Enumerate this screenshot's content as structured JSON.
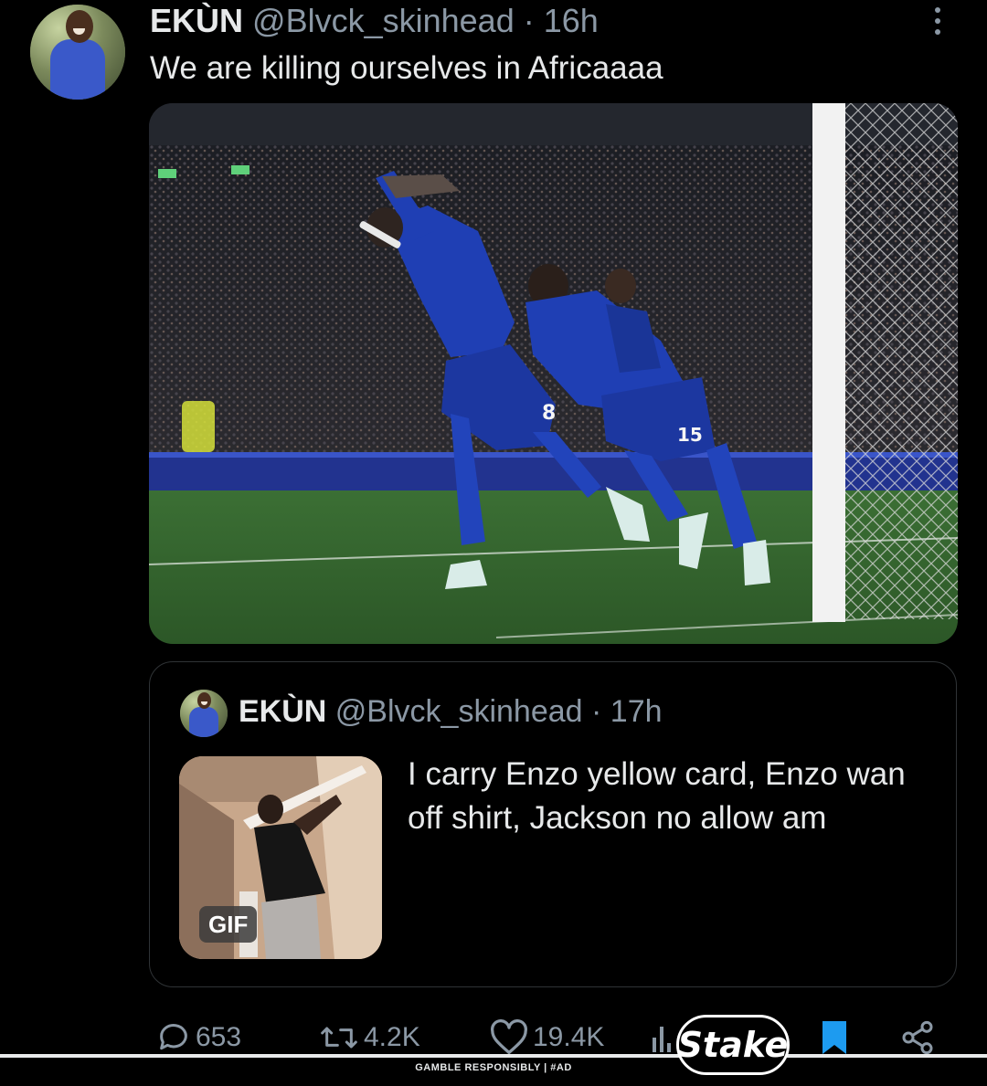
{
  "tweet": {
    "display_name": "EKÙN",
    "handle": "@Blvck_skinhead",
    "separator": "·",
    "time": "16h",
    "text": "We are killing ourselves in Africaaaa"
  },
  "quote": {
    "display_name": "EKÙN",
    "handle": "@Blvck_skinhead",
    "separator": "·",
    "time": "17h",
    "text": "I carry Enzo yellow card, Enzo wan off shirt, Jackson no allow am",
    "gif_badge": "GIF"
  },
  "photo": {
    "shirt_numbers": [
      "8",
      "15"
    ]
  },
  "actions": {
    "replies": "653",
    "reposts": "4.2K",
    "likes": "19.4K"
  },
  "ad": {
    "brand": "Stake",
    "disclaimer": "GAMBLE RESPONSIBLY  |  #AD"
  },
  "colors": {
    "background": "#000000",
    "text": "#e7e9ea",
    "muted": "#8b98a5",
    "bookmark_active": "#1d9bf0",
    "kit_blue": "#1f3fb4"
  }
}
